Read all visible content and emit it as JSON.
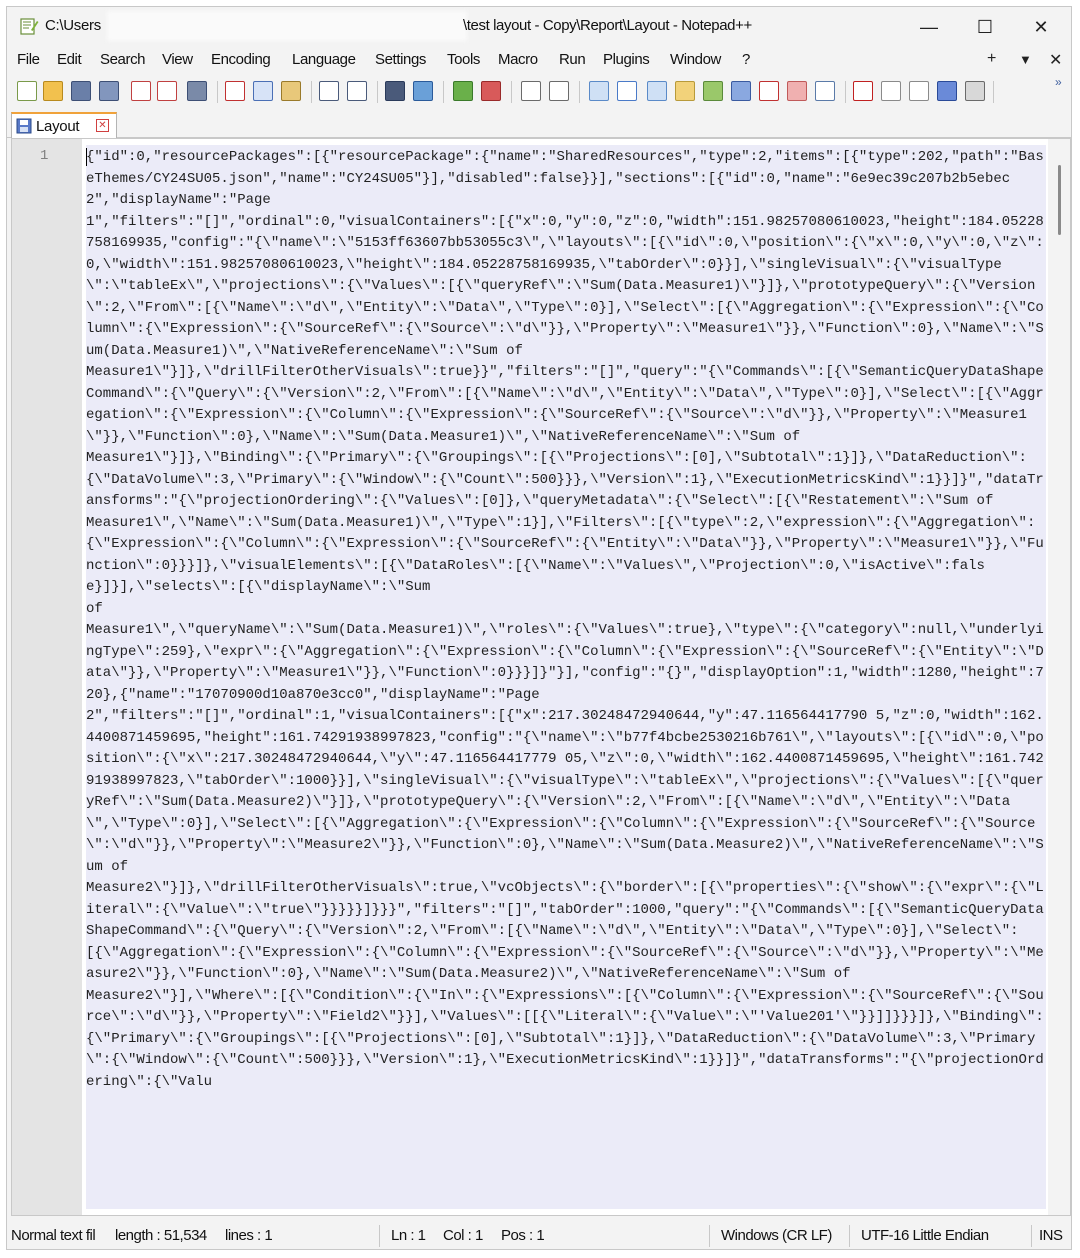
{
  "window": {
    "path_prefix": "C:\\Users",
    "title": "\\test layout - Copy\\Report\\Layout - Notepad++",
    "controls": {
      "minimize": "—",
      "maximize": "☐",
      "close": "✕"
    }
  },
  "menu": {
    "items": [
      "File",
      "Edit",
      "Search",
      "View",
      "Encoding",
      "Language",
      "Settings",
      "Tools",
      "Macro",
      "Run",
      "Plugins",
      "Window",
      "?"
    ],
    "right": {
      "add": "+",
      "dropdown": "▼",
      "close": "✕"
    }
  },
  "toolbar": {
    "more": "»"
  },
  "tab": {
    "label": "Layout",
    "close": "✕"
  },
  "editor": {
    "line_number": "1",
    "content": "{\"id\":0,\"resourcePackages\":[{\"resourcePackage\":{\"name\":\"SharedResources\",\"type\":2,\"items\":[{\"type\":202,\"path\":\"BaseThemes/CY24SU05.json\",\"name\":\"CY24SU05\"}],\"disabled\":false}}],\"sections\":[{\"id\":0,\"name\":\"6e9ec39c207b2b5ebec2\",\"displayName\":\"Page\n1\",\"filters\":\"[]\",\"ordinal\":0,\"visualContainers\":[{\"x\":0,\"y\":0,\"z\":0,\"width\":151.98257080610023,\"height\":184.05228758169935,\"config\":\"{\\\"name\\\":\\\"5153ff63607bb53055c3\\\",\\\"layouts\\\":[{\\\"id\\\":0,\\\"position\\\":{\\\"x\\\":0,\\\"y\\\":0,\\\"z\\\":0,\\\"width\\\":151.98257080610023,\\\"height\\\":184.05228758169935,\\\"tabOrder\\\":0}}],\\\"singleVisual\\\":{\\\"visualType\\\":\\\"tableEx\\\",\\\"projections\\\":{\\\"Values\\\":[{\\\"queryRef\\\":\\\"Sum(Data.Measure1)\\\"}]},\\\"prototypeQuery\\\":{\\\"Version\\\":2,\\\"From\\\":[{\\\"Name\\\":\\\"d\\\",\\\"Entity\\\":\\\"Data\\\",\\\"Type\\\":0}],\\\"Select\\\":[{\\\"Aggregation\\\":{\\\"Expression\\\":{\\\"Column\\\":{\\\"Expression\\\":{\\\"SourceRef\\\":{\\\"Source\\\":\\\"d\\\"}},\\\"Property\\\":\\\"Measure1\\\"}},\\\"Function\\\":0},\\\"Name\\\":\\\"Sum(Data.Measure1)\\\",\\\"NativeReferenceName\\\":\\\"Sum of\nMeasure1\\\"}]},\\\"drillFilterOtherVisuals\\\":true}}\",\"filters\":\"[]\",\"query\":\"{\\\"Commands\\\":[{\\\"SemanticQueryDataShapeCommand\\\":{\\\"Query\\\":{\\\"Version\\\":2,\\\"From\\\":[{\\\"Name\\\":\\\"d\\\",\\\"Entity\\\":\\\"Data\\\",\\\"Type\\\":0}],\\\"Select\\\":[{\\\"Aggregation\\\":{\\\"Expression\\\":{\\\"Column\\\":{\\\"Expression\\\":{\\\"SourceRef\\\":{\\\"Source\\\":\\\"d\\\"}},\\\"Property\\\":\\\"Measure1\\\"}},\\\"Function\\\":0},\\\"Name\\\":\\\"Sum(Data.Measure1)\\\",\\\"NativeReferenceName\\\":\\\"Sum of\nMeasure1\\\"}]},\\\"Binding\\\":{\\\"Primary\\\":{\\\"Groupings\\\":[{\\\"Projections\\\":[0],\\\"Subtotal\\\":1}]},\\\"DataReduction\\\":{\\\"DataVolume\\\":3,\\\"Primary\\\":{\\\"Window\\\":{\\\"Count\\\":500}}},\\\"Version\\\":1},\\\"ExecutionMetricsKind\\\":1}}]}\",\"dataTransforms\":\"{\\\"projectionOrdering\\\":{\\\"Values\\\":[0]},\\\"queryMetadata\\\":{\\\"Select\\\":[{\\\"Restatement\\\":\\\"Sum of\nMeasure1\\\",\\\"Name\\\":\\\"Sum(Data.Measure1)\\\",\\\"Type\\\":1}],\\\"Filters\\\":[{\\\"type\\\":2,\\\"expression\\\":{\\\"Aggregation\\\":{\\\"Expression\\\":{\\\"Column\\\":{\\\"Expression\\\":{\\\"SourceRef\\\":{\\\"Entity\\\":\\\"Data\\\"}},\\\"Property\\\":\\\"Measure1\\\"}},\\\"Function\\\":0}}}]},\\\"visualElements\\\":[{\\\"DataRoles\\\":[{\\\"Name\\\":\\\"Values\\\",\\\"Projection\\\":0,\\\"isActive\\\":false}]}],\\\"selects\\\":[{\\\"displayName\\\":\\\"Sum\nof\nMeasure1\\\",\\\"queryName\\\":\\\"Sum(Data.Measure1)\\\",\\\"roles\\\":{\\\"Values\\\":true},\\\"type\\\":{\\\"category\\\":null,\\\"underlyingType\\\":259},\\\"expr\\\":{\\\"Aggregation\\\":{\\\"Expression\\\":{\\\"Column\\\":{\\\"Expression\\\":{\\\"SourceRef\\\":{\\\"Entity\\\":\\\"Data\\\"}},\\\"Property\\\":\\\"Measure1\\\"}},\\\"Function\\\":0}}}]}\"}],\"config\":\"{}\",\"displayOption\":1,\"width\":1280,\"height\":720},{\"name\":\"17070900d10a870e3cc0\",\"displayName\":\"Page\n2\",\"filters\":\"[]\",\"ordinal\":1,\"visualContainers\":[{\"x\":217.30248472940644,\"y\":47.116564417790 5,\"z\":0,\"width\":162.4400871459695,\"height\":161.74291938997823,\"config\":\"{\\\"name\\\":\\\"b77f4bcbe2530216b761\\\",\\\"layouts\\\":[{\\\"id\\\":0,\\\"position\\\":{\\\"x\\\":217.30248472940644,\\\"y\\\":47.116564417779 05,\\\"z\\\":0,\\\"width\\\":162.4400871459695,\\\"height\\\":161.74291938997823,\\\"tabOrder\\\":1000}}],\\\"singleVisual\\\":{\\\"visualType\\\":\\\"tableEx\\\",\\\"projections\\\":{\\\"Values\\\":[{\\\"queryRef\\\":\\\"Sum(Data.Measure2)\\\"}]},\\\"prototypeQuery\\\":{\\\"Version\\\":2,\\\"From\\\":[{\\\"Name\\\":\\\"d\\\",\\\"Entity\\\":\\\"Data\\\",\\\"Type\\\":0}],\\\"Select\\\":[{\\\"Aggregation\\\":{\\\"Expression\\\":{\\\"Column\\\":{\\\"Expression\\\":{\\\"SourceRef\\\":{\\\"Source\\\":\\\"d\\\"}},\\\"Property\\\":\\\"Measure2\\\"}},\\\"Function\\\":0},\\\"Name\\\":\\\"Sum(Data.Measure2)\\\",\\\"NativeReferenceName\\\":\\\"Sum of\nMeasure2\\\"}]},\\\"drillFilterOtherVisuals\\\":true,\\\"vcObjects\\\":{\\\"border\\\":[{\\\"properties\\\":{\\\"show\\\":{\\\"expr\\\":{\\\"Literal\\\":{\\\"Value\\\":\\\"true\\\"}}}}}]}}}\",\"filters\":\"[]\",\"tabOrder\":1000,\"query\":\"{\\\"Commands\\\":[{\\\"SemanticQueryDataShapeCommand\\\":{\\\"Query\\\":{\\\"Version\\\":2,\\\"From\\\":[{\\\"Name\\\":\\\"d\\\",\\\"Entity\\\":\\\"Data\\\",\\\"Type\\\":0}],\\\"Select\\\":[{\\\"Aggregation\\\":{\\\"Expression\\\":{\\\"Column\\\":{\\\"Expression\\\":{\\\"SourceRef\\\":{\\\"Source\\\":\\\"d\\\"}},\\\"Property\\\":\\\"Measure2\\\"}},\\\"Function\\\":0},\\\"Name\\\":\\\"Sum(Data.Measure2)\\\",\\\"NativeReferenceName\\\":\\\"Sum of\nMeasure2\\\"}],\\\"Where\\\":[{\\\"Condition\\\":{\\\"In\\\":{\\\"Expressions\\\":[{\\\"Column\\\":{\\\"Expression\\\":{\\\"SourceRef\\\":{\\\"Source\\\":\\\"d\\\"}},\\\"Property\\\":\\\"Field2\\\"}}],\\\"Values\\\":[[{\\\"Literal\\\":{\\\"Value\\\":\\\"'Value201'\\\"}}]]}}}]},\\\"Binding\\\":{\\\"Primary\\\":{\\\"Groupings\\\":[{\\\"Projections\\\":[0],\\\"Subtotal\\\":1}]},\\\"DataReduction\\\":{\\\"DataVolume\\\":3,\\\"Primary\\\":{\\\"Window\\\":{\\\"Count\\\":500}}},\\\"Version\\\":1},\\\"ExecutionMetricsKind\\\":1}}]}\",\"dataTransforms\":\"{\\\"projectionOrdering\\\":{\\\"Valu"
  },
  "status": {
    "type": "Normal text fil",
    "length": "length : 51,534",
    "lines": "lines : 1",
    "ln": "Ln : 1",
    "col": "Col : 1",
    "pos": "Pos : 1",
    "eol": "Windows (CR LF)",
    "encoding": "UTF-16 Little Endian",
    "mode": "INS"
  }
}
